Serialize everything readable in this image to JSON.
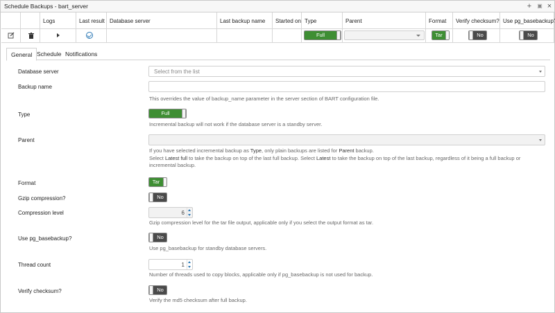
{
  "window": {
    "title": "Schedule Backups - bart_server",
    "add_icon": "+",
    "save_icon": "▣",
    "close_icon": "×"
  },
  "grid": {
    "headers": {
      "logs": "Logs",
      "last_result": "Last result",
      "database_server": "Database server",
      "last_backup_name": "Last backup name",
      "started_on": "Started on",
      "type": "Type",
      "parent": "Parent",
      "format": "Format",
      "verify_checksum": "Verify checksum?",
      "use_pg_basebackup": "Use pg_basebackup?"
    },
    "row": {
      "type": "Full",
      "format": "Tar",
      "verify_checksum": "No",
      "use_pg_basebackup": "No"
    }
  },
  "tabs": [
    "General",
    "Schedule",
    "Notifications"
  ],
  "form": {
    "database_server": {
      "label": "Database server",
      "placeholder": "Select from the list"
    },
    "backup_name": {
      "label": "Backup name",
      "value": "",
      "help": "This overrides the value of backup_name parameter in the server section of BART configuration file."
    },
    "type": {
      "label": "Type",
      "value": "Full",
      "help": "Incremental backup will not work if the database server is a standby server."
    },
    "parent": {
      "label": "Parent",
      "help1_pre": "If you have selected incremental backup as ",
      "help1_type": "Type",
      "help1_mid": ", only plain backups are listed for ",
      "help1_parent": "Parent",
      "help1_post": " backup.",
      "help2_pre": "Select ",
      "help2_latest_full": "Latest full",
      "help2_mid": " to take the backup on top of the last full backup. Select ",
      "help2_latest": "Latest",
      "help2_post": " to take the backup on top of the last backup, regardless of it being a full backup or",
      "help3": "incremental backup."
    },
    "format": {
      "label": "Format",
      "value": "Tar"
    },
    "gzip_compression": {
      "label": "Gzip compression?",
      "value": "No"
    },
    "compression_level": {
      "label": "Compression level",
      "value": "6",
      "help": "Gzip compression level for the tar file output, applicable only if you select the output format as tar."
    },
    "use_pg_basebackup": {
      "label": "Use pg_basebackup?",
      "value": "No",
      "help": "Use pg_basebackup for standby database servers."
    },
    "thread_count": {
      "label": "Thread count",
      "value": "1",
      "help": "Number of threads used to copy blocks, applicable only if pg_basebackup is not used for backup."
    },
    "verify_checksum": {
      "label": "Verify checksum?",
      "value": "No",
      "help": "Verify the md5 checksum after full backup."
    }
  },
  "colors": {
    "toggle_on": "#3e8e33",
    "toggle_off": "#4a4a4a",
    "accent": "#2b78b5"
  }
}
